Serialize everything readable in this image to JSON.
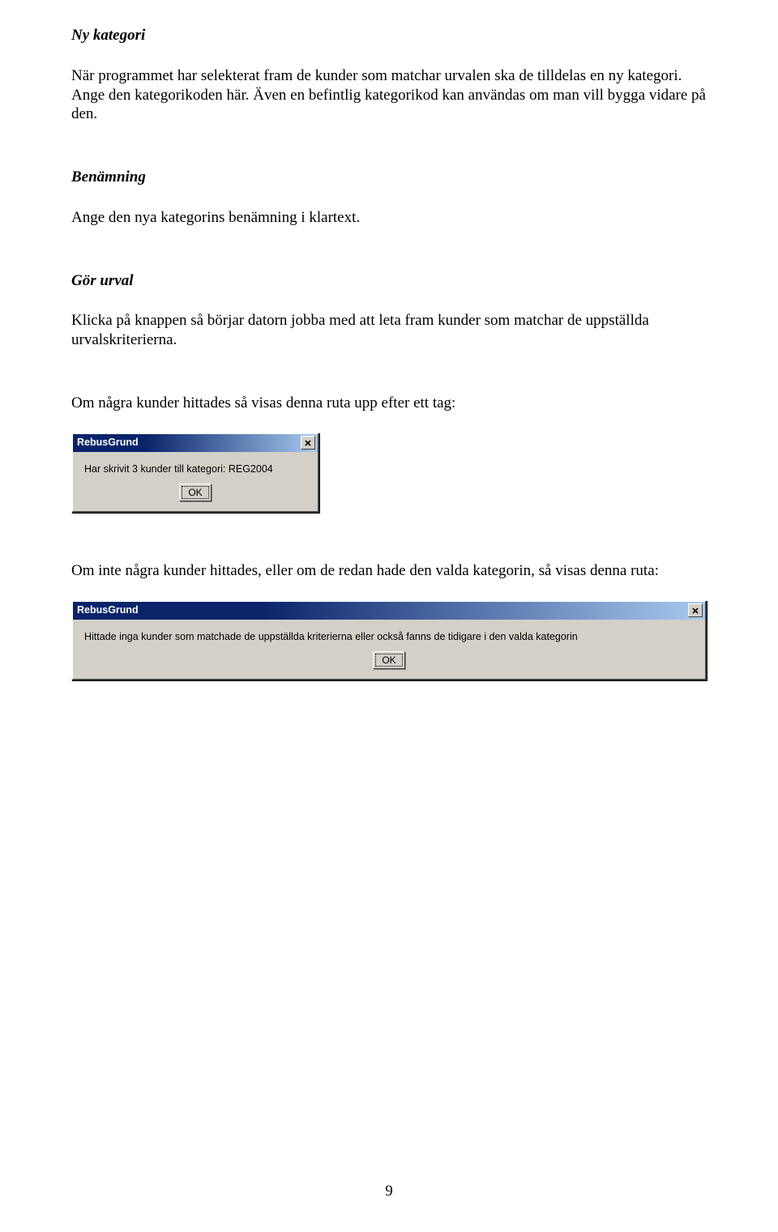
{
  "sections": {
    "nykategori": {
      "heading": "Ny kategori",
      "para": "När programmet har selekterat fram de kunder som matchar urvalen ska de tilldelas en ny kategori. Ange den kategorikoden här. Även en befintlig kategorikod kan användas om man vill bygga vidare på den."
    },
    "benamning": {
      "heading": "Benämning",
      "para": "Ange den nya kategorins benämning i klartext."
    },
    "gorurval": {
      "heading": "Gör urval",
      "para": "Klicka på knappen så börjar datorn jobba med att leta fram kunder som matchar de uppställda urvalskriterierna."
    },
    "afterfound": "Om några kunder hittades så visas denna ruta upp efter ett tag:",
    "afternotfound": "Om inte några kunder hittades, eller om de redan hade den valda kategorin, så visas denna ruta:"
  },
  "dialog1": {
    "title": "RebusGrund",
    "message": "Har skrivit 3 kunder till kategori: REG2004",
    "ok": "OK"
  },
  "dialog2": {
    "title": "RebusGrund",
    "message": "Hittade inga kunder som matchade de uppställda kriterierna eller också fanns de tidigare i den valda kategorin",
    "ok": "OK"
  },
  "pageNumber": "9"
}
